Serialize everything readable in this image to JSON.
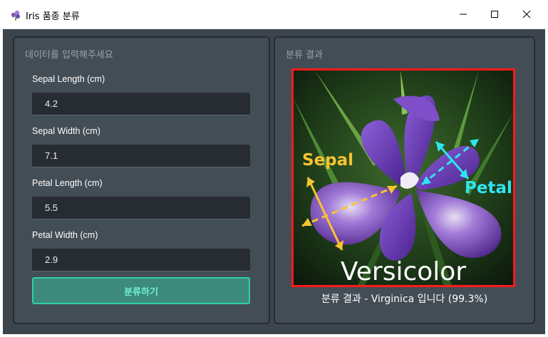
{
  "window": {
    "title": "Iris 품종 분류"
  },
  "input_panel": {
    "title": "데이터를 입력해주세요",
    "fields": [
      {
        "label": "Sepal Length (cm)",
        "value": "4.2"
      },
      {
        "label": "Sepal Width (cm)",
        "value": "7.1"
      },
      {
        "label": "Petal Length (cm)",
        "value": "5.5"
      },
      {
        "label": "Petal Width (cm)",
        "value": "2.9"
      }
    ],
    "classify_button": "분류하기"
  },
  "result_panel": {
    "title": "분류 결과",
    "image_labels": {
      "sepal": "Sepal",
      "petal": "Petal",
      "species": "Versicolor"
    },
    "result_text": "분류 결과 - Virginica 입니다 (99.3%)"
  },
  "colors": {
    "panel_bg": "#434d55",
    "accent_teal": "#2fd0a8",
    "sepal_arrow": "#f7c331",
    "petal_arrow": "#2ee6f0",
    "image_border": "#ff1a1a"
  }
}
